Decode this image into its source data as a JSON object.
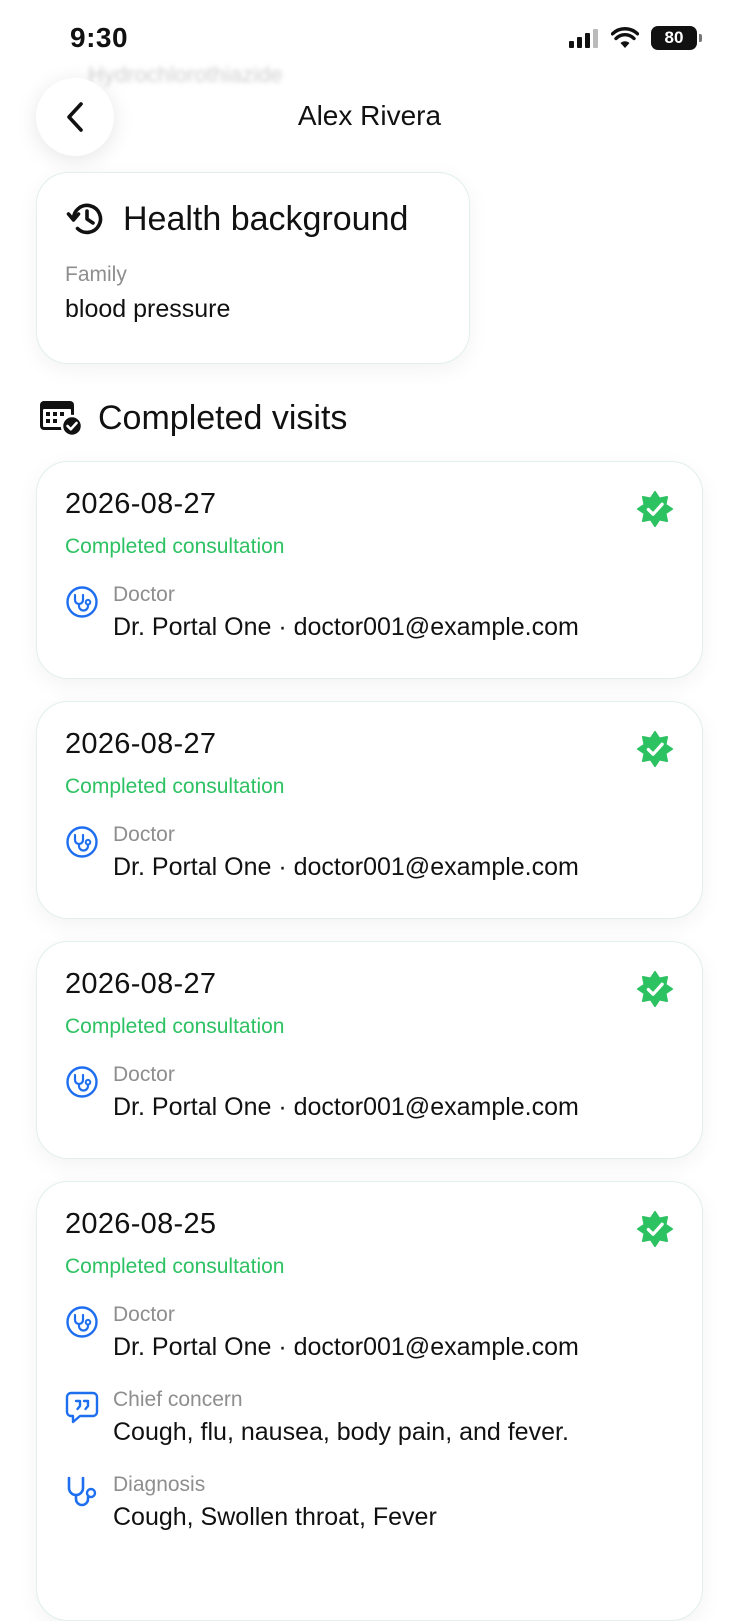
{
  "status_bar": {
    "time": "9:30",
    "battery": "80"
  },
  "ghost_text": "Hydrochlorothiazide",
  "header": {
    "title": "Alex Rivera"
  },
  "health_background": {
    "title": "Health background",
    "label": "Family",
    "value": "blood pressure"
  },
  "completed_visits": {
    "title": "Completed visits",
    "visits": [
      {
        "date": "2026-08-27",
        "status": "Completed consultation",
        "doctor_label": "Doctor",
        "doctor": "Dr. Portal One · doctor001@example.com"
      },
      {
        "date": "2026-08-27",
        "status": "Completed consultation",
        "doctor_label": "Doctor",
        "doctor": "Dr. Portal One · doctor001@example.com"
      },
      {
        "date": "2026-08-27",
        "status": "Completed consultation",
        "doctor_label": "Doctor",
        "doctor": "Dr. Portal One · doctor001@example.com"
      },
      {
        "date": "2026-08-25",
        "status": "Completed consultation",
        "doctor_label": "Doctor",
        "doctor": "Dr. Portal One · doctor001@example.com",
        "chief_concern_label": "Chief concern",
        "chief_concern": "Cough, flu, nausea, body pain, and fever.",
        "diagnosis_label": "Diagnosis",
        "diagnosis": "Cough, Swollen throat, Fever"
      }
    ]
  },
  "colors": {
    "accent_green": "#2cc262",
    "icon_blue": "#1e6ff0",
    "label_gray": "#8e8e8e"
  },
  "icons": [
    "signal-icon",
    "wifi-icon",
    "battery-icon",
    "chevron-left-icon",
    "history-icon",
    "calendar-check-icon",
    "verified-badge-icon",
    "stethoscope-icon",
    "quote-bubble-icon"
  ]
}
